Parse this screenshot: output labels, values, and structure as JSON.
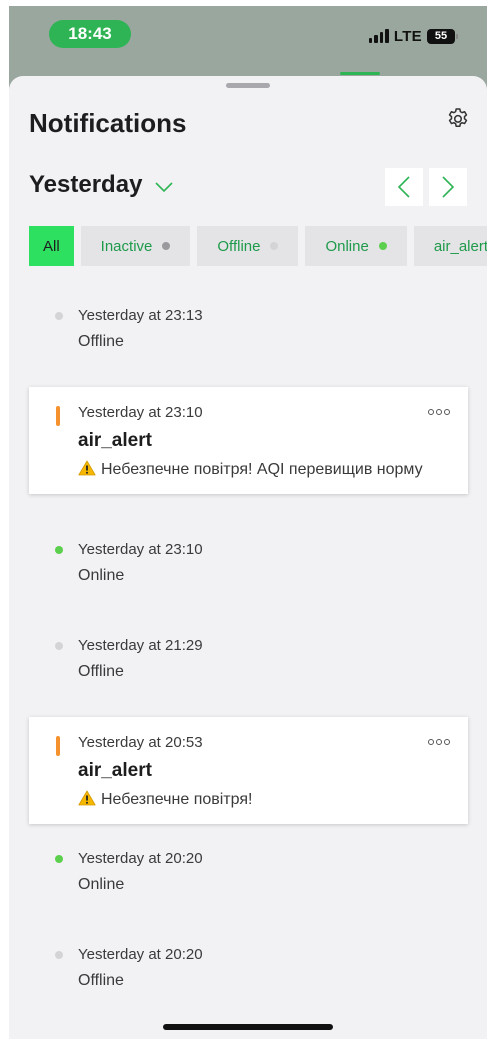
{
  "status_bar": {
    "time": "18:43",
    "network": "LTE",
    "battery": "55"
  },
  "header": {
    "title": "Notifications",
    "settings_icon": "gear-icon"
  },
  "date_selector": {
    "label": "Yesterday"
  },
  "filters": [
    {
      "label": "All",
      "active": true
    },
    {
      "label": "Inactive"
    },
    {
      "label": "Offline"
    },
    {
      "label": "Online"
    },
    {
      "label": "air_alert"
    }
  ],
  "notifications": [
    {
      "type": "status",
      "time": "Yesterday at 23:13",
      "status": "Offline"
    },
    {
      "type": "alert",
      "time": "Yesterday at 23:10",
      "title": "air_alert",
      "message": "Небезпечне повітря! AQI перевищив норму"
    },
    {
      "type": "status",
      "time": "Yesterday at 23:10",
      "status": "Online"
    },
    {
      "type": "status",
      "time": "Yesterday at 21:29",
      "status": "Offline"
    },
    {
      "type": "alert",
      "time": "Yesterday at 20:53",
      "title": "air_alert",
      "message": "Небезпечне повітря!"
    },
    {
      "type": "status",
      "time": "Yesterday at 20:20",
      "status": "Online"
    },
    {
      "type": "status",
      "time": "Yesterday at 20:20",
      "status": "Offline"
    }
  ],
  "colors": {
    "accent": "#2ee060",
    "filter_text": "#1e9a4a",
    "online": "#5ccf4e",
    "offline": "#d4d4d6",
    "alert_bar": "#f5922e"
  }
}
